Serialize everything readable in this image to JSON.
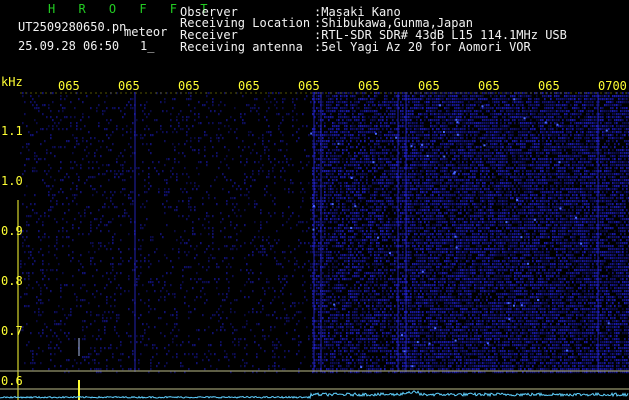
{
  "header": {
    "app_name": "H R O F F T",
    "filename": "UT2509280650.pn",
    "mode": "meteor",
    "datetime": "25.09.28 06:50",
    "counter": "1_",
    "observer_label": "Observer",
    "observer_value": ":Masaki Kano",
    "location_label": "Receiving Location",
    "location_value": ":Shibukawa,Gunma,Japan",
    "receiver_label": "Receiver",
    "receiver_value": ":RTL-SDR SDR# 43dB L15 114.1MHz USB",
    "antenna_label": "Receiving antenna",
    "antenna_value": ":5el Yagi Az 20 for Aomori VOR"
  },
  "axis": {
    "unit_label": "kHz",
    "time_ticks": [
      "065",
      "065",
      "065",
      "065",
      "065",
      "065",
      "065",
      "065",
      "065",
      "0700"
    ],
    "freq_ticks": [
      "1.1",
      "1.0",
      "0.9",
      "0.8",
      "0.7",
      "0.6"
    ]
  },
  "colors": {
    "background": "#000000",
    "noise": "#1a1aa0",
    "signal": "#5fd0ff",
    "axis": "#ffff33",
    "title": "#22cc22"
  }
}
